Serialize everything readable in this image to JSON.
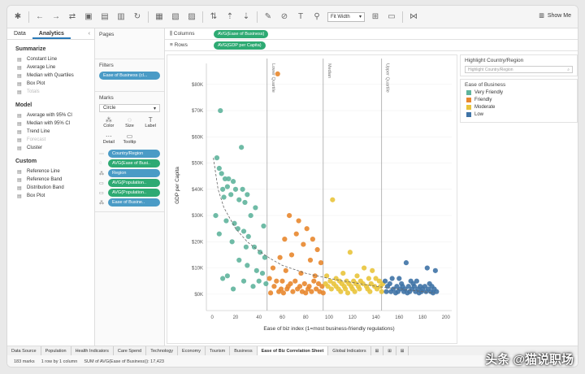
{
  "toolbar": {
    "fit_label": "Fit Width",
    "show_me_label": "Show Me"
  },
  "left_tabs": [
    "Data",
    "Analytics"
  ],
  "analytics": {
    "summarize_title": "Summarize",
    "summarize": [
      {
        "label": "Constant Line"
      },
      {
        "label": "Average Line"
      },
      {
        "label": "Median with Quartiles"
      },
      {
        "label": "Box Plot"
      },
      {
        "label": "Totals",
        "disabled": true
      }
    ],
    "model_title": "Model",
    "model": [
      {
        "label": "Average with 95% CI"
      },
      {
        "label": "Median with 95% CI"
      },
      {
        "label": "Trend Line"
      },
      {
        "label": "Forecast",
        "disabled": true
      },
      {
        "label": "Cluster"
      }
    ],
    "custom_title": "Custom",
    "custom": [
      {
        "label": "Reference Line"
      },
      {
        "label": "Reference Band"
      },
      {
        "label": "Distribution Band"
      },
      {
        "label": "Box Plot"
      }
    ]
  },
  "pages_title": "Pages",
  "filters": {
    "title": "Filters",
    "pill": "Ease of Business (cl..."
  },
  "marks": {
    "title": "Marks",
    "type": "Circle",
    "buttons": [
      "Color",
      "Size",
      "Label",
      "Detail",
      "Tooltip"
    ],
    "pills": [
      {
        "label": "Country/Region",
        "color": "blue"
      },
      {
        "label": "AVG(Ease of Busi..",
        "color": "green"
      },
      {
        "label": "Region",
        "color": "blue"
      },
      {
        "label": "AVG(Population..",
        "color": "green"
      },
      {
        "label": "AVG(Population..",
        "color": "green"
      },
      {
        "label": "Ease of Busine..",
        "color": "blue"
      }
    ]
  },
  "shelves": {
    "columns_label": "Columns",
    "columns_pill": "AVG(Ease of Business)",
    "rows_label": "Rows",
    "rows_pill": "AVG(GDP per Capita)"
  },
  "highlight": {
    "title": "Highlight Country/Region",
    "placeholder": "Highlight Country/Region"
  },
  "legend": {
    "title": "Ease of Business",
    "items": [
      {
        "label": "Very Friendly",
        "color": "#5fb49c"
      },
      {
        "label": "Friendly",
        "color": "#e8872e"
      },
      {
        "label": "Moderate",
        "color": "#e9c43b"
      },
      {
        "label": "Low",
        "color": "#3f73a6"
      }
    ]
  },
  "sheet_tabs": [
    {
      "label": "Data Source"
    },
    {
      "label": "Population"
    },
    {
      "label": "Health Indicators"
    },
    {
      "label": "Care Spend"
    },
    {
      "label": "Technology"
    },
    {
      "label": "Economy"
    },
    {
      "label": "Tourism"
    },
    {
      "label": "Business"
    },
    {
      "label": "Ease of Biz Correlation Sheet",
      "active": true
    },
    {
      "label": "Global Indicators"
    }
  ],
  "status": {
    "marks": "183 marks",
    "rows": "1 row by 1 column",
    "sum": "SUM of AVG(Ease of Business)): 17,423"
  },
  "watermark": "头条 @猫说职场",
  "chart_data": {
    "type": "scatter",
    "xlabel": "Ease of biz index (1=most business-friendly regulations)",
    "ylabel": "GDP per Capita",
    "xlim": [
      -5,
      205
    ],
    "ylim": [
      -5000,
      88000
    ],
    "x_ticks": [
      "0",
      "20",
      "40",
      "60",
      "80",
      "100",
      "120",
      "140",
      "160",
      "180",
      "200"
    ],
    "y_ticks": [
      "$0K",
      "$10K",
      "$20K",
      "$30K",
      "$40K",
      "$50K",
      "$60K",
      "$70K",
      "$80K"
    ],
    "y_tick_values": [
      0,
      10000,
      20000,
      30000,
      40000,
      50000,
      60000,
      70000,
      80000
    ],
    "x_tick_values": [
      0,
      20,
      40,
      60,
      80,
      100,
      120,
      140,
      160,
      180,
      200
    ],
    "reference_lines": [
      {
        "label": "Lower Quartile",
        "x": 47
      },
      {
        "label": "Median",
        "x": 95
      },
      {
        "label": "Upper Quartile",
        "x": 145
      }
    ],
    "trend": "logarithmic",
    "trend_points": {
      "x": [
        1,
        5,
        10,
        20,
        30,
        40,
        50,
        60,
        80,
        100,
        120,
        140,
        160,
        180,
        190
      ],
      "y": [
        52000,
        40000,
        33000,
        25000,
        20000,
        16500,
        13500,
        11000,
        8000,
        6000,
        4500,
        3000,
        2000,
        1000,
        500
      ]
    },
    "series": [
      {
        "name": "Very Friendly",
        "color": "#5fb49c",
        "points": [
          [
            7,
            70000
          ],
          [
            25,
            56000
          ],
          [
            4,
            52000
          ],
          [
            6,
            48000
          ],
          [
            8,
            46000
          ],
          [
            11,
            44000
          ],
          [
            14,
            44000
          ],
          [
            18,
            43000
          ],
          [
            9,
            40000
          ],
          [
            13,
            41000
          ],
          [
            20,
            40000
          ],
          [
            26,
            40000
          ],
          [
            30,
            38000
          ],
          [
            16,
            38000
          ],
          [
            10,
            37000
          ],
          [
            23,
            36000
          ],
          [
            28,
            35000
          ],
          [
            37,
            33000
          ],
          [
            33,
            30000
          ],
          [
            3,
            30000
          ],
          [
            12,
            28000
          ],
          [
            19,
            27000
          ],
          [
            22,
            25000
          ],
          [
            27,
            24000
          ],
          [
            31,
            22000
          ],
          [
            44,
            26000
          ],
          [
            6,
            23000
          ],
          [
            17,
            20000
          ],
          [
            29,
            18000
          ],
          [
            36,
            18000
          ],
          [
            41,
            16000
          ],
          [
            45,
            14000
          ],
          [
            23,
            13000
          ],
          [
            30,
            11000
          ],
          [
            38,
            9000
          ],
          [
            43,
            8000
          ],
          [
            13,
            7000
          ],
          [
            9,
            6000
          ],
          [
            27,
            5000
          ],
          [
            40,
            5000
          ],
          [
            46,
            4000
          ],
          [
            35,
            3000
          ],
          [
            18,
            2000
          ]
        ]
      },
      {
        "name": "Friendly",
        "color": "#e8872e",
        "points": [
          [
            56,
            84000
          ],
          [
            66,
            30000
          ],
          [
            74,
            28000
          ],
          [
            81,
            25000
          ],
          [
            72,
            23000
          ],
          [
            62,
            21000
          ],
          [
            86,
            21000
          ],
          [
            78,
            19000
          ],
          [
            90,
            17000
          ],
          [
            68,
            15000
          ],
          [
            58,
            14000
          ],
          [
            84,
            13000
          ],
          [
            93,
            12000
          ],
          [
            52,
            10000
          ],
          [
            63,
            9000
          ],
          [
            76,
            8000
          ],
          [
            88,
            7000
          ],
          [
            49,
            6000
          ],
          [
            55,
            5000
          ],
          [
            60,
            5000
          ],
          [
            67,
            4000
          ],
          [
            71,
            5000
          ],
          [
            79,
            4000
          ],
          [
            83,
            3000
          ],
          [
            87,
            5000
          ],
          [
            91,
            4000
          ],
          [
            94,
            3000
          ],
          [
            53,
            3000
          ],
          [
            59,
            2000
          ],
          [
            64,
            2000
          ],
          [
            69,
            1000
          ],
          [
            73,
            2000
          ],
          [
            77,
            1000
          ],
          [
            82,
            2000
          ],
          [
            85,
            1000
          ],
          [
            89,
            2000
          ],
          [
            92,
            1000
          ],
          [
            57,
            1000
          ],
          [
            61,
            500
          ],
          [
            65,
            3000
          ],
          [
            75,
            3000
          ],
          [
            80,
            500
          ],
          [
            50,
            500
          ],
          [
            95,
            500
          ]
        ]
      },
      {
        "name": "Moderate",
        "color": "#e9c43b",
        "points": [
          [
            103,
            36000
          ],
          [
            118,
            16000
          ],
          [
            130,
            10000
          ],
          [
            137,
            9000
          ],
          [
            112,
            8000
          ],
          [
            98,
            7000
          ],
          [
            124,
            7000
          ],
          [
            134,
            6000
          ],
          [
            106,
            6000
          ],
          [
            140,
            6000
          ],
          [
            101,
            5000
          ],
          [
            109,
            5000
          ],
          [
            115,
            5000
          ],
          [
            121,
            5000
          ],
          [
            127,
            5000
          ],
          [
            143,
            5000
          ],
          [
            97,
            4000
          ],
          [
            104,
            4000
          ],
          [
            111,
            4000
          ],
          [
            117,
            4000
          ],
          [
            123,
            4000
          ],
          [
            129,
            4000
          ],
          [
            136,
            4000
          ],
          [
            146,
            4000
          ],
          [
            99,
            3000
          ],
          [
            106,
            3000
          ],
          [
            113,
            3000
          ],
          [
            119,
            3000
          ],
          [
            125,
            3000
          ],
          [
            132,
            3000
          ],
          [
            139,
            3000
          ],
          [
            144,
            3000
          ],
          [
            102,
            2000
          ],
          [
            108,
            2000
          ],
          [
            114,
            2000
          ],
          [
            120,
            2000
          ],
          [
            126,
            2000
          ],
          [
            133,
            2000
          ],
          [
            141,
            2000
          ],
          [
            110,
            1000
          ],
          [
            122,
            1000
          ],
          [
            135,
            1000
          ],
          [
            145,
            1000
          ],
          [
            116,
            500
          ]
        ]
      },
      {
        "name": "Low",
        "color": "#3f73a6",
        "points": [
          [
            166,
            12000
          ],
          [
            184,
            10000
          ],
          [
            191,
            9000
          ],
          [
            154,
            6000
          ],
          [
            160,
            6000
          ],
          [
            175,
            5000
          ],
          [
            148,
            5000
          ],
          [
            170,
            5000
          ],
          [
            186,
            4000
          ],
          [
            152,
            4000
          ],
          [
            158,
            3000
          ],
          [
            163,
            3000
          ],
          [
            168,
            3000
          ],
          [
            173,
            3000
          ],
          [
            178,
            3000
          ],
          [
            182,
            3000
          ],
          [
            188,
            3000
          ],
          [
            150,
            3000
          ],
          [
            155,
            2000
          ],
          [
            161,
            2000
          ],
          [
            165,
            2000
          ],
          [
            171,
            2000
          ],
          [
            176,
            2000
          ],
          [
            180,
            2000
          ],
          [
            185,
            2000
          ],
          [
            190,
            2000
          ],
          [
            153,
            1000
          ],
          [
            159,
            1000
          ],
          [
            164,
            1000
          ],
          [
            169,
            1000
          ],
          [
            174,
            1000
          ],
          [
            179,
            1000
          ],
          [
            183,
            1000
          ],
          [
            187,
            1000
          ],
          [
            192,
            1000
          ],
          [
            157,
            500
          ],
          [
            167,
            500
          ],
          [
            177,
            500
          ],
          [
            189,
            500
          ],
          [
            149,
            1000
          ],
          [
            162,
            4000
          ],
          [
            172,
            4000
          ]
        ]
      }
    ]
  }
}
